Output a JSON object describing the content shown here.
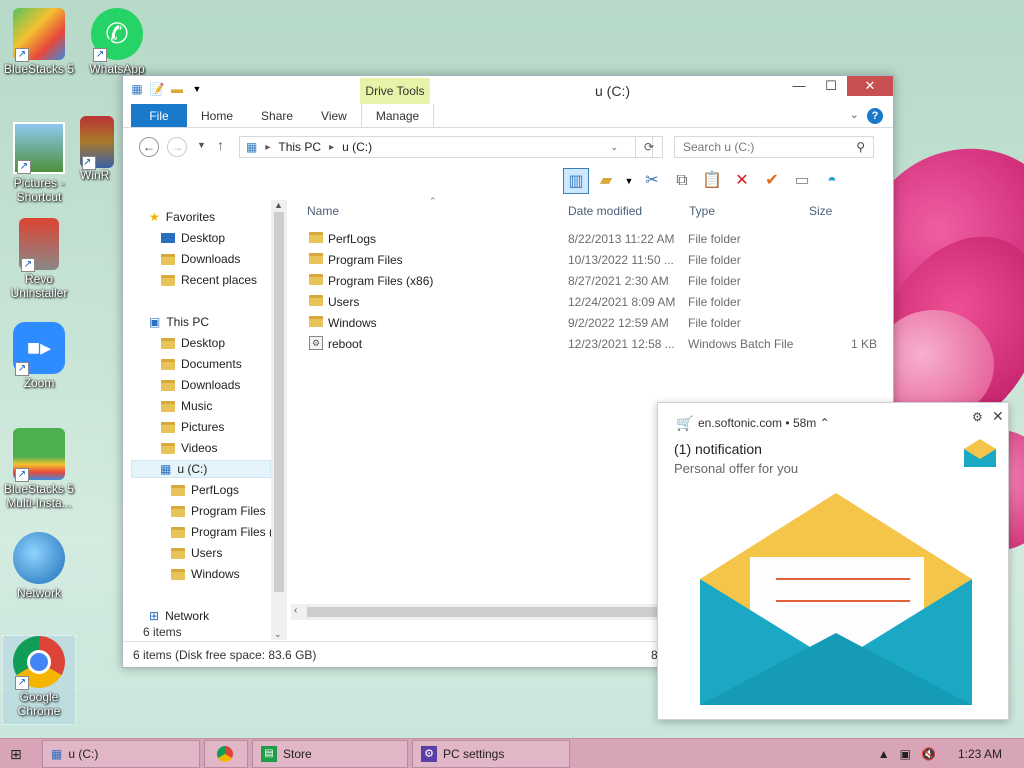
{
  "desktop": {
    "icons": [
      {
        "label": "BlueStacks 5"
      },
      {
        "label": "WhatsApp"
      },
      {
        "label": "Pictures - Shortcut"
      },
      {
        "label": "WinR"
      },
      {
        "label": "Revo Uninstaller"
      },
      {
        "label": "Zoom"
      },
      {
        "label": "BlueStacks 5 Multi-Insta..."
      },
      {
        "label": "Network"
      },
      {
        "label": "Google Chrome"
      }
    ]
  },
  "window": {
    "title": "u (C:)",
    "contextual_group": "Drive Tools",
    "ribbon_tabs": [
      "File",
      "Home",
      "Share",
      "View",
      "Manage"
    ],
    "address": {
      "segments": [
        "This PC",
        "u (C:)"
      ]
    },
    "search_placeholder": "Search u (C:)",
    "nav": {
      "favorites": "Favorites",
      "fav_items": [
        "Desktop",
        "Downloads",
        "Recent places"
      ],
      "thispc": "This PC",
      "pc_items": [
        "Desktop",
        "Documents",
        "Downloads",
        "Music",
        "Pictures",
        "Videos"
      ],
      "drive": "u (C:)",
      "drive_items": [
        "PerfLogs",
        "Program Files",
        "Program Files (",
        "Users",
        "Windows"
      ],
      "network": "Network"
    },
    "columns": {
      "name": "Name",
      "date": "Date modified",
      "type": "Type",
      "size": "Size"
    },
    "files": [
      {
        "name": "PerfLogs",
        "date": "8/22/2013 11:22 AM",
        "type": "File folder",
        "size": ""
      },
      {
        "name": "Program Files",
        "date": "10/13/2022 11:50 ...",
        "type": "File folder",
        "size": ""
      },
      {
        "name": "Program Files (x86)",
        "date": "8/27/2021 2:30 AM",
        "type": "File folder",
        "size": ""
      },
      {
        "name": "Users",
        "date": "12/24/2021 8:09 AM",
        "type": "File folder",
        "size": ""
      },
      {
        "name": "Windows",
        "date": "9/2/2022 12:59 AM",
        "type": "File folder",
        "size": ""
      },
      {
        "name": "reboot",
        "date": "12/23/2021 12:58 ...",
        "type": "Windows Batch File",
        "size": "1 KB"
      }
    ],
    "item_count": "6 items",
    "status": "6 items (Disk free space: 83.6 GB)",
    "status_extra": "8"
  },
  "notification": {
    "source": "en.softonic.com",
    "age": "58m",
    "title": "(1) notification",
    "body": "Personal offer for you",
    "colors": {
      "envelope_teal": "#1aa8c5",
      "envelope_yellow": "#f5c54a",
      "letter_lines": "#e2603b"
    }
  },
  "taskbar": {
    "buttons": [
      {
        "label": "u (C:)"
      },
      {
        "label": ""
      },
      {
        "label": "Store"
      },
      {
        "label": "PC settings"
      }
    ],
    "clock": "1:23 AM"
  }
}
